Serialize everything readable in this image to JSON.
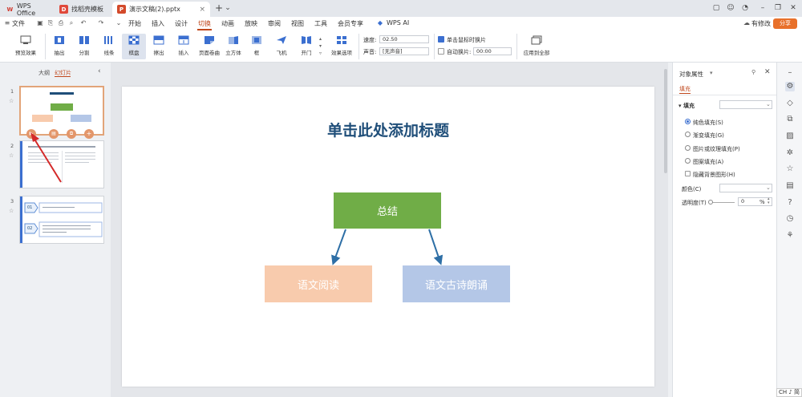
{
  "tabs": [
    {
      "label": "WPS Office",
      "icon": "wps-logo-icon"
    },
    {
      "label": "找稻壳模板",
      "icon": "docer-icon"
    },
    {
      "label": "演示文稿(2).pptx",
      "icon": "presentation-icon"
    }
  ],
  "menu": {
    "file": "文件",
    "items": [
      "开始",
      "插入",
      "设计",
      "切换",
      "动画",
      "放映",
      "审阅",
      "视图",
      "工具",
      "会员专享"
    ],
    "active": "切换",
    "wps_ai": "WPS AI",
    "modified": "有修改",
    "share": "分享"
  },
  "ribbon": {
    "preview": "预览效果",
    "effects": [
      "抽出",
      "分割",
      "线条",
      "棋盘",
      "擦出",
      "插入",
      "页面卷曲",
      "立方体",
      "框",
      "飞机",
      "开门"
    ],
    "selected_effect": "棋盘",
    "effect_options": "效果选项",
    "speed_label": "速度:",
    "speed_value": "02.50",
    "sound_label": "声音:",
    "sound_value": "[无声音]",
    "click_advance": "单击鼠标时换片",
    "auto_advance": "自动换片:",
    "auto_time": "00:00",
    "apply_all": "应用到全部"
  },
  "left_panel": {
    "tab_outline": "大纲",
    "tab_slides": "幻灯片",
    "slide_numbers": [
      "1",
      "2",
      "3"
    ],
    "thumb3_items": [
      "01",
      "02"
    ]
  },
  "slide": {
    "title": "单击此处添加标题",
    "top_node": "总结",
    "left_node": "语文阅读",
    "right_node": "语文古诗朗诵",
    "colors": {
      "title": "#1f4e79",
      "top": "#70ad47",
      "left": "#f8cbad",
      "right": "#b4c7e7",
      "arrow": "#2e6fa6"
    }
  },
  "properties": {
    "title": "对象属性",
    "tab": "填充",
    "section": "填充",
    "options": [
      "纯色填充(S)",
      "渐变填充(G)",
      "图片或纹理填充(P)",
      "图案填充(A)"
    ],
    "selected_option": "纯色填充(S)",
    "hide_bg": "隐藏背景图形(H)",
    "color_label": "颜色(C)",
    "transparency_label": "透明度(T)",
    "transparency_value": "0",
    "percent": "%"
  },
  "ime": "CH ♪ 简"
}
